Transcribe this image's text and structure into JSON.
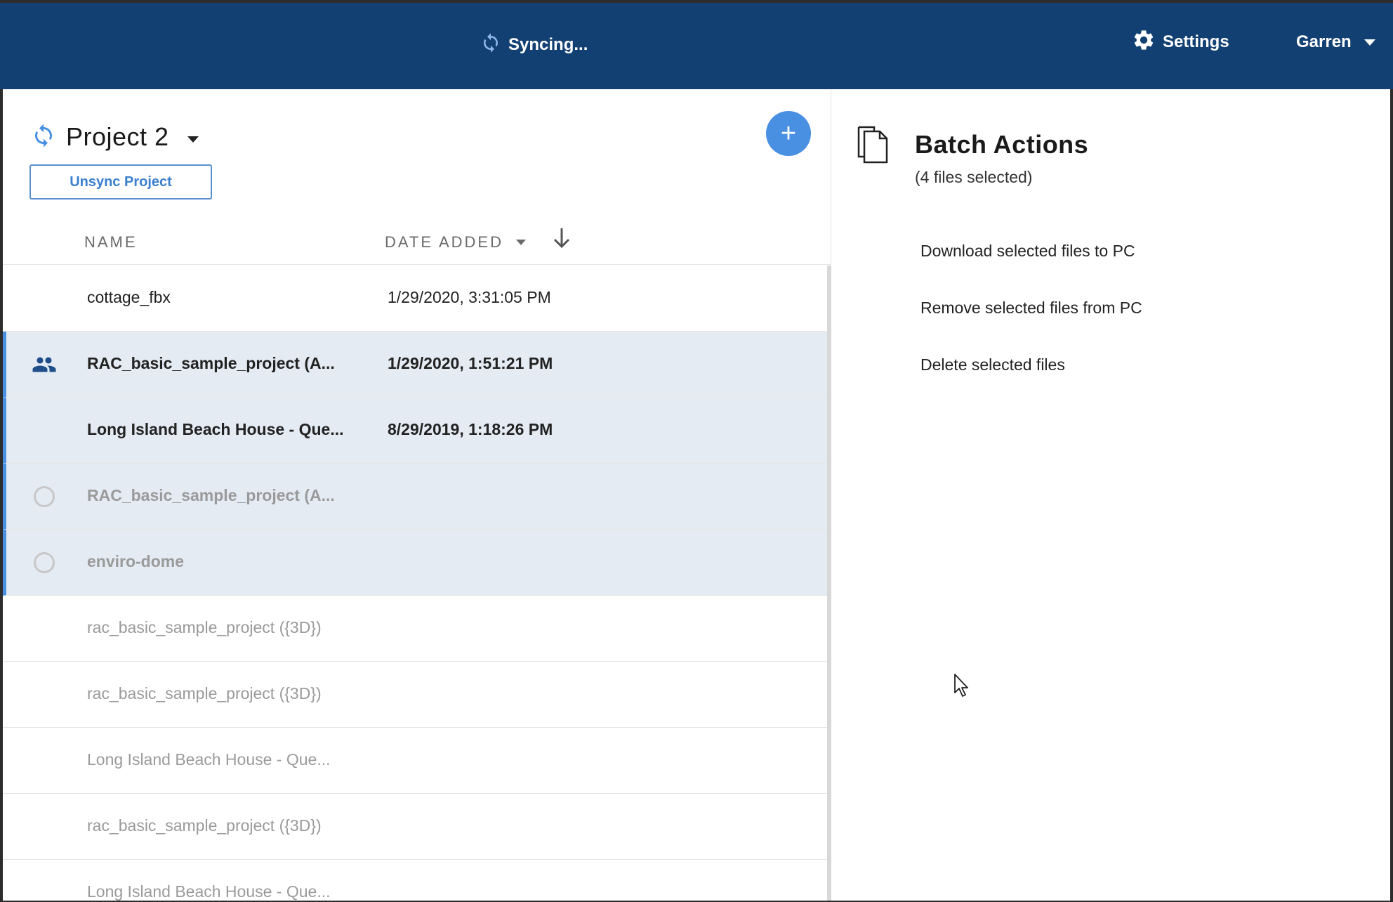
{
  "topbar": {
    "sync_status": "Syncing...",
    "settings_label": "Settings",
    "user_name": "Garren",
    "background_color": "#134073"
  },
  "project": {
    "title": "Project 2",
    "unsync_label": "Unsync Project",
    "add_label": "+"
  },
  "columns": {
    "name": "NAME",
    "date_added": "DATE ADDED"
  },
  "files": [
    {
      "name": "cottage_fbx",
      "date": "1/29/2020, 3:31:05 PM"
    },
    {
      "name": "RAC_basic_sample_project (A...",
      "date": "1/29/2020, 1:51:21 PM"
    },
    {
      "name": "Long Island Beach House - Que...",
      "date": "8/29/2019, 1:18:26 PM"
    },
    {
      "name": "RAC_basic_sample_project (A...",
      "date": ""
    },
    {
      "name": "enviro-dome",
      "date": ""
    },
    {
      "name": "rac_basic_sample_project ({3D})",
      "date": ""
    },
    {
      "name": "rac_basic_sample_project ({3D})",
      "date": ""
    },
    {
      "name": "Long Island Beach House - Que...",
      "date": ""
    },
    {
      "name": "rac_basic_sample_project ({3D})",
      "date": ""
    },
    {
      "name": "Long Island Beach House - Que...",
      "date": ""
    }
  ],
  "batch": {
    "title": "Batch Actions",
    "subtitle": "(4 files selected)",
    "actions": [
      "Download selected files to PC",
      "Remove selected files from PC",
      "Delete selected files"
    ]
  },
  "colors": {
    "accent": "#4a90e2",
    "selected_row": "#e5ebf3"
  }
}
